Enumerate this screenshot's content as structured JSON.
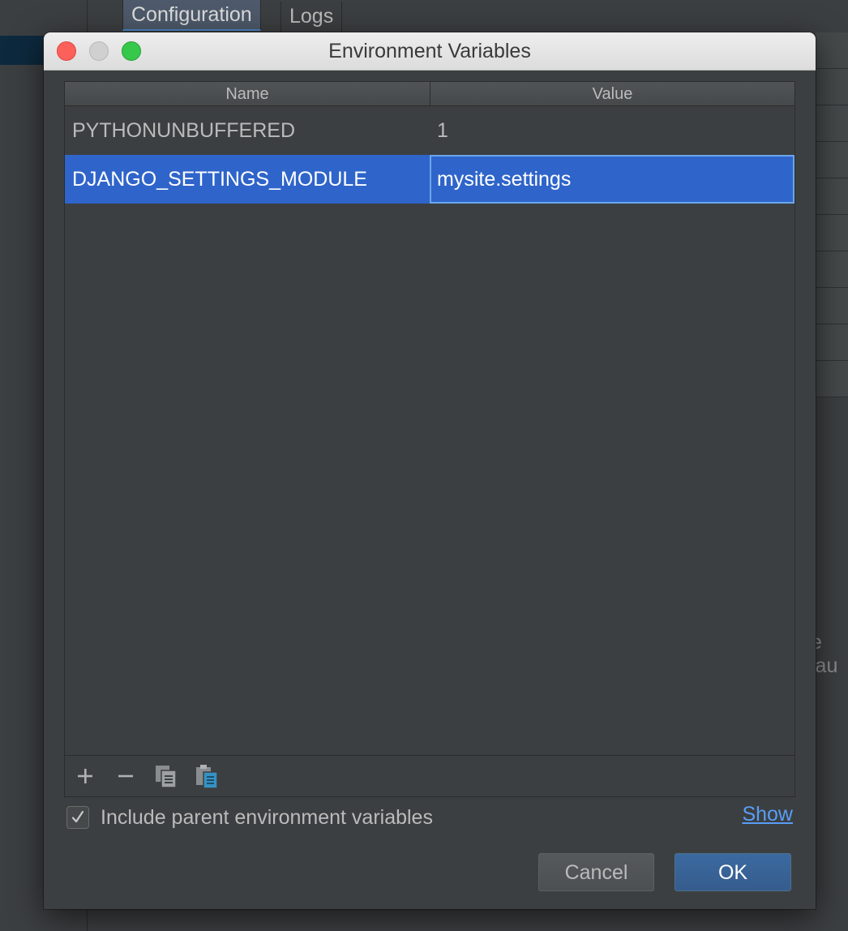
{
  "background": {
    "tabs": [
      {
        "label": "Configuration",
        "active": true
      },
      {
        "label": "Logs",
        "active": false
      }
    ],
    "right_text": "e lau"
  },
  "dialog": {
    "title": "Environment Variables",
    "table": {
      "columns": [
        "Name",
        "Value"
      ],
      "rows": [
        {
          "name": "PYTHONUNBUFFERED",
          "value": "1",
          "selected": false
        },
        {
          "name": "DJANGO_SETTINGS_MODULE",
          "value": "mysite.settings",
          "selected": true
        }
      ]
    },
    "toolbar": {
      "buttons": [
        {
          "icon": "add-icon",
          "glyph": "+"
        },
        {
          "icon": "remove-icon",
          "glyph": "−"
        },
        {
          "icon": "copy-icon"
        },
        {
          "icon": "paste-icon"
        }
      ]
    },
    "include_parent": {
      "label": "Include parent environment variables",
      "checked": true
    },
    "show_link": "Show",
    "buttons": {
      "cancel": "Cancel",
      "ok": "OK"
    }
  },
  "colors": {
    "selection": "#2f65ca",
    "link": "#589df6",
    "ok_button": "#365c8d"
  }
}
